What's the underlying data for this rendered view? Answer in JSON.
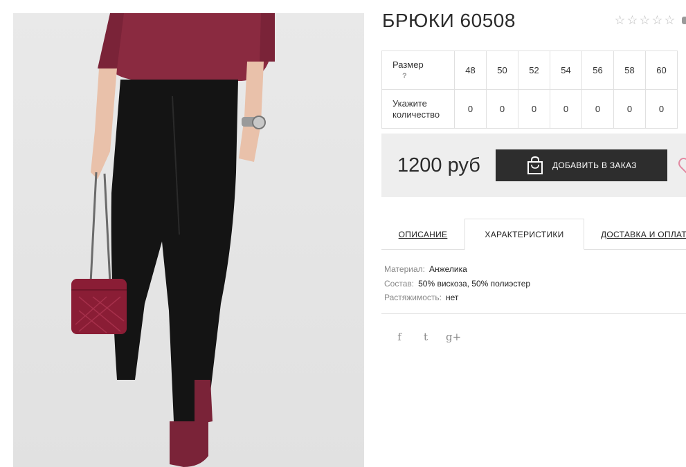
{
  "product": {
    "title": "БРЮКИ 60508",
    "rating": {
      "value": 0,
      "max": 5
    }
  },
  "size_table": {
    "size_label": "Размер",
    "help_mark": "?",
    "qty_label": "Укажите количество",
    "sizes": [
      "48",
      "50",
      "52",
      "54",
      "56",
      "58",
      "60"
    ],
    "quantities": [
      "0",
      "0",
      "0",
      "0",
      "0",
      "0",
      "0"
    ]
  },
  "purchase": {
    "price": "1200 руб",
    "order_button": "ДОБАВИТЬ В ЗАКАЗ"
  },
  "tabs": [
    {
      "label": "ОПИСАНИЕ",
      "active": false
    },
    {
      "label": "ХАРАКТЕРИСТИКИ",
      "active": true
    },
    {
      "label": "ДОСТАВКА И ОПЛАТА",
      "active": false
    }
  ],
  "characteristics": [
    {
      "key": "Материал:",
      "value": "Анжелика"
    },
    {
      "key": "Состав:",
      "value": "50% вискоза, 50% полиэстер"
    },
    {
      "key": "Растяжимость:",
      "value": "нет"
    }
  ],
  "social": {
    "facebook": "f",
    "twitter": "t",
    "googleplus": "g+"
  },
  "icons": [
    "star-icon",
    "shopping-bag-icon",
    "heart-icon",
    "facebook-icon",
    "twitter-icon",
    "google-plus-icon"
  ],
  "colors": {
    "button_bg": "#2d2d2d",
    "price_box_bg": "#eeeeee",
    "heart": "#e28aa2",
    "star": "#bdbdbd"
  }
}
